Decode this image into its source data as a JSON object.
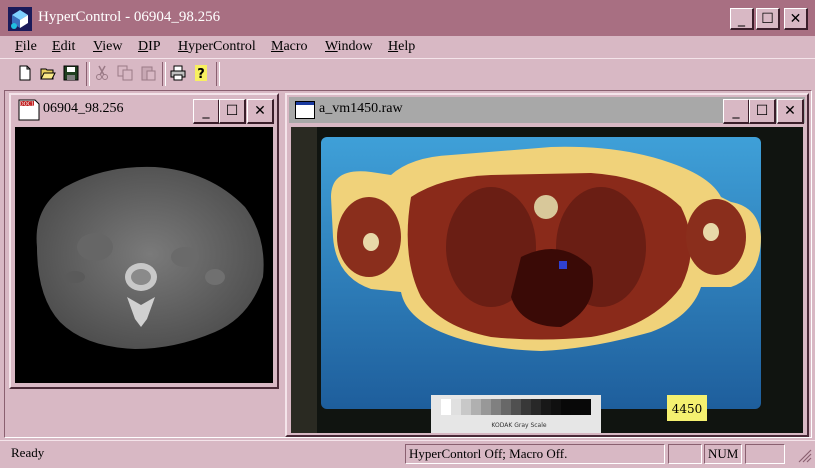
{
  "app": {
    "title": "HyperControl - 06904_98.256"
  },
  "window_buttons": {
    "minimize": "_",
    "maximize": "☐",
    "close": "✕"
  },
  "menu": [
    {
      "label": "File"
    },
    {
      "label": "Edit"
    },
    {
      "label": "View"
    },
    {
      "label": "DIP"
    },
    {
      "label": "HyperControl"
    },
    {
      "label": "Macro"
    },
    {
      "label": "Window"
    },
    {
      "label": "Help"
    }
  ],
  "toolbar": {
    "icons": [
      "new-file-icon",
      "open-folder-icon",
      "save-disk-icon",
      "cut-icon",
      "copy-icon",
      "paste-icon",
      "print-icon",
      "help-icon"
    ],
    "help_glyph": "?"
  },
  "windows": {
    "ct": {
      "title": "06904_98.256",
      "icon_text": "DOC1"
    },
    "raw": {
      "title": "a_vm1450.raw"
    }
  },
  "image": {
    "tag_label": "4450",
    "scale_label": "KODAK Gray Scale"
  },
  "status": {
    "ready": "Ready",
    "hyper": "HyperContorl Off; Macro Off.",
    "num": "NUM"
  },
  "colors": {
    "title_active": "#a86f82",
    "chrome": "#d8b8c4",
    "phantom_blue": "#3a8fc4"
  }
}
